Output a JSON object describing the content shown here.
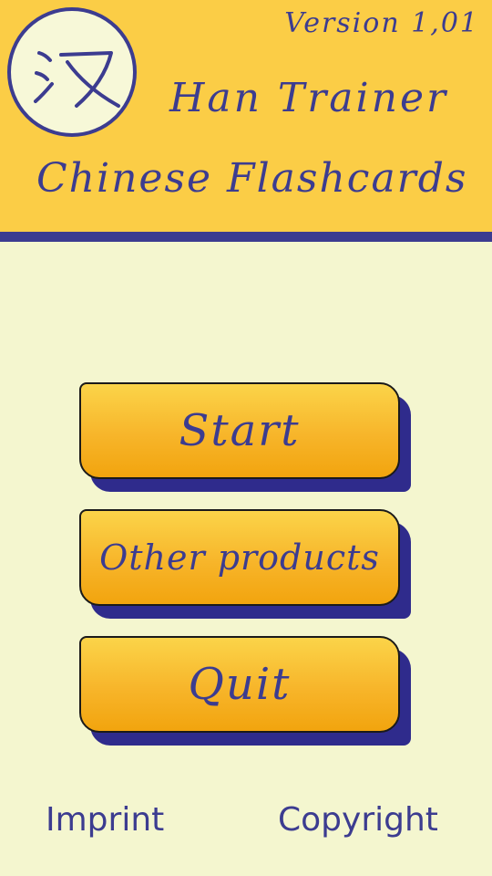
{
  "header": {
    "version": "Version 1,01",
    "title_line1": "Han Trainer",
    "title_line2": "Chinese Flashcards",
    "logo_glyph": "汉"
  },
  "menu": {
    "start_label": "Start",
    "other_products_label": "Other products",
    "quit_label": "Quit"
  },
  "footer": {
    "imprint_label": "Imprint",
    "copyright_label": "Copyright"
  },
  "colors": {
    "header_bg": "#fbcd46",
    "accent": "#3c3c90",
    "page_bg": "#f4f6cf",
    "button_orange": "#f7b52a"
  }
}
